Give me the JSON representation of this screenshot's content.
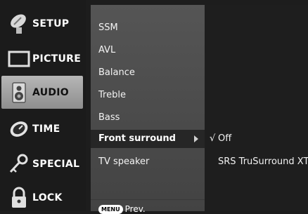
{
  "categories": [
    {
      "label": "SETUP",
      "icon": "satellite-dish-icon",
      "active": false
    },
    {
      "label": "PICTURE",
      "icon": "tv-screen-icon",
      "active": false
    },
    {
      "label": "AUDIO",
      "icon": "speaker-icon",
      "active": true
    },
    {
      "label": "TIME",
      "icon": "clock-icon",
      "active": false
    },
    {
      "label": "SPECIAL",
      "icon": "key-icon",
      "active": false
    },
    {
      "label": "LOCK",
      "icon": "padlock-icon",
      "active": false
    }
  ],
  "submenu": {
    "items": [
      "SSM",
      "AVL",
      "Balance",
      "Treble",
      "Bass"
    ],
    "selected": "Front surround",
    "after": "TV speaker",
    "footer_key": "MENU",
    "footer_label": "Prev."
  },
  "options": {
    "checkmark": "√",
    "items": [
      "Off",
      "SRS TruSurround XT"
    ]
  },
  "colors": {
    "selected_bar": "#262626",
    "submenu_bg": "#4d4d4d",
    "active_category": "#a3a3a3"
  }
}
